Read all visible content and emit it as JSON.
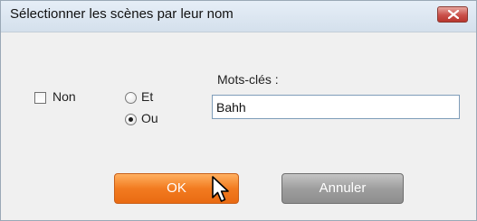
{
  "window": {
    "title": "Sélectionner les scènes par leur nom",
    "close_icon": "close-x-icon"
  },
  "options": {
    "not_checkbox": {
      "label": "Non",
      "checked": false
    },
    "logic": [
      {
        "label": "Et",
        "selected": false
      },
      {
        "label": "Ou",
        "selected": true
      }
    ]
  },
  "keywords": {
    "label": "Mots-clés :",
    "value": "Bahh"
  },
  "buttons": {
    "ok_label": "OK",
    "cancel_label": "Annuler"
  },
  "colors": {
    "ok_button": "#f27b20",
    "cancel_button": "#9e9e9e",
    "close_button": "#c9504a"
  }
}
